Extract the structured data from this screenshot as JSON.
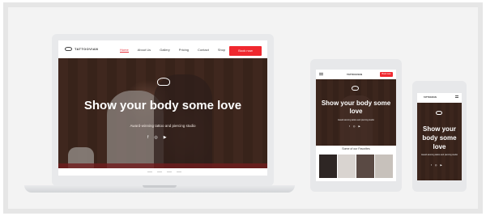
{
  "brand": {
    "logo_text": "TATTOOVIAN",
    "accent": "#f0282f"
  },
  "laptop": {
    "nav_items": [
      {
        "label": "Home",
        "active": true
      },
      {
        "label": "About Us",
        "active": false
      },
      {
        "label": "Gallery",
        "active": false
      },
      {
        "label": "Pricing",
        "active": false
      },
      {
        "label": "Contact",
        "active": false
      },
      {
        "label": "Shop",
        "active": false
      }
    ],
    "cta_label": "Book now",
    "hero_title": "Show your body some love",
    "hero_subtitle": "Award-winning tattoo and piercing studio",
    "social_icons": [
      "facebook-icon",
      "instagram-icon",
      "youtube-icon"
    ]
  },
  "tablet": {
    "logo_text": "TATTOOVIAN",
    "cta_label": "Book now",
    "hero_title": "Show your body some love",
    "hero_subtitle": "Award-winning tattoo and piercing studio",
    "favorites_heading": "Some of our Favorites"
  },
  "phone": {
    "logo_text": "TATTOOVIAN",
    "hero_title": "Show your body some love",
    "hero_subtitle": "Award-winning tattoo and piercing studio"
  },
  "glyphs": {
    "facebook": "f",
    "instagram": "◎",
    "youtube": "▶"
  }
}
